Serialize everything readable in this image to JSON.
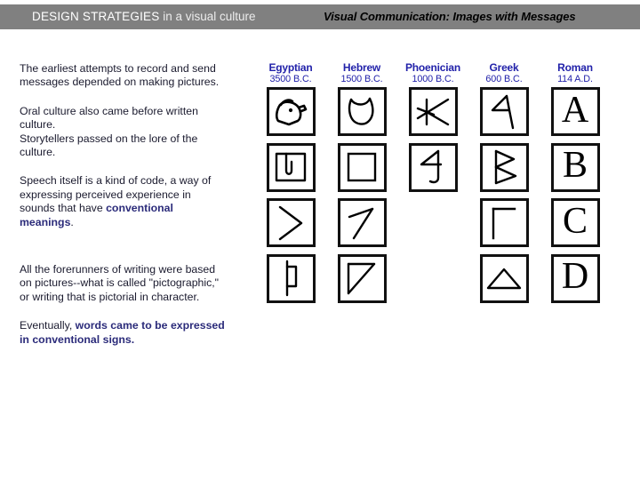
{
  "header": {
    "left_title_strong": "DESIGN STRATEGIES",
    "left_title_light": " in a visual culture",
    "right_title": "Visual Communication: Images with Messages",
    "bar_color": "#808080"
  },
  "left_column": {
    "paragraphs": [
      {
        "id": "p1",
        "runs": [
          {
            "text": "The earliest attempts to record and send messages depended on making pictures.",
            "bold": false
          }
        ]
      },
      {
        "id": "p2",
        "runs": [
          {
            "text": "Oral culture also came before written culture.",
            "bold": false
          }
        ]
      },
      {
        "id": "p3",
        "runs": [
          {
            "text": "Storytellers passed on the lore of the culture.",
            "bold": false
          }
        ]
      },
      {
        "id": "p4",
        "runs": [
          {
            "text": "Speech itself is a kind of code, a way of expressing perceived experience in sounds that have ",
            "bold": false
          },
          {
            "text": "conventional meanings",
            "bold": true
          },
          {
            "text": ".",
            "bold": false
          }
        ]
      },
      {
        "id": "p5",
        "runs": [
          {
            "text": "All the forerunners of writing were based on pictures--what is called \"pictographic,\" or writing that is pictorial in character.",
            "bold": false
          }
        ]
      },
      {
        "id": "p6",
        "runs": [
          {
            "text": "Eventually, ",
            "bold": false
          },
          {
            "text": "words came to be expressed in conventional signs.",
            "bold": true
          }
        ]
      }
    ],
    "emphasis_color": "#2b2b7a",
    "body_color": "#1a1a2e"
  },
  "alphabet_table": {
    "header_color": "#2222aa",
    "columns": [
      {
        "name": "Egyptian",
        "date": "3500 B.C."
      },
      {
        "name": "Hebrew",
        "date": "1500 B.C."
      },
      {
        "name": "Phoenician",
        "date": "1000 B.C."
      },
      {
        "name": "Greek",
        "date": "600 B.C."
      },
      {
        "name": "Roman",
        "date": "114 A.D."
      }
    ],
    "rows": [
      {
        "letter": "A",
        "cells": [
          {
            "column": "Egyptian",
            "glyph": "ox-head-pictograph",
            "present": true
          },
          {
            "column": "Hebrew",
            "glyph": "aleph-inverted-u",
            "present": true
          },
          {
            "column": "Phoenician",
            "glyph": "aleph-rotated-k",
            "present": true
          },
          {
            "column": "Greek",
            "glyph": "alpha-angular-triangle",
            "present": true
          },
          {
            "column": "Roman",
            "glyph": "letter-A",
            "present": true,
            "text": "A"
          }
        ]
      },
      {
        "letter": "B",
        "cells": [
          {
            "column": "Egyptian",
            "glyph": "house-floorplan-pictograph",
            "present": true
          },
          {
            "column": "Hebrew",
            "glyph": "beth-square",
            "present": true
          },
          {
            "column": "Phoenician",
            "glyph": "beth-figure-four",
            "present": true
          },
          {
            "column": "Greek",
            "glyph": "beta-double-triangle",
            "present": true
          },
          {
            "column": "Roman",
            "glyph": "letter-B",
            "present": true,
            "text": "B"
          }
        ]
      },
      {
        "letter": "C",
        "cells": [
          {
            "column": "Egyptian",
            "glyph": "boomerang-chevron-pictograph",
            "present": true
          },
          {
            "column": "Hebrew",
            "glyph": "gimel-diagonal-hook",
            "present": true
          },
          {
            "column": "Phoenician",
            "glyph": "",
            "present": false
          },
          {
            "column": "Greek",
            "glyph": "gamma-corner",
            "present": true
          },
          {
            "column": "Roman",
            "glyph": "letter-C",
            "present": true,
            "text": "C"
          }
        ]
      },
      {
        "letter": "D",
        "cells": [
          {
            "column": "Egyptian",
            "glyph": "door-panel-pictograph",
            "present": true
          },
          {
            "column": "Hebrew",
            "glyph": "daleth-right-triangle",
            "present": true
          },
          {
            "column": "Phoenician",
            "glyph": "",
            "present": false
          },
          {
            "column": "Greek",
            "glyph": "delta-triangle",
            "present": true
          },
          {
            "column": "Roman",
            "glyph": "letter-D",
            "present": true,
            "text": "D"
          }
        ]
      }
    ]
  }
}
